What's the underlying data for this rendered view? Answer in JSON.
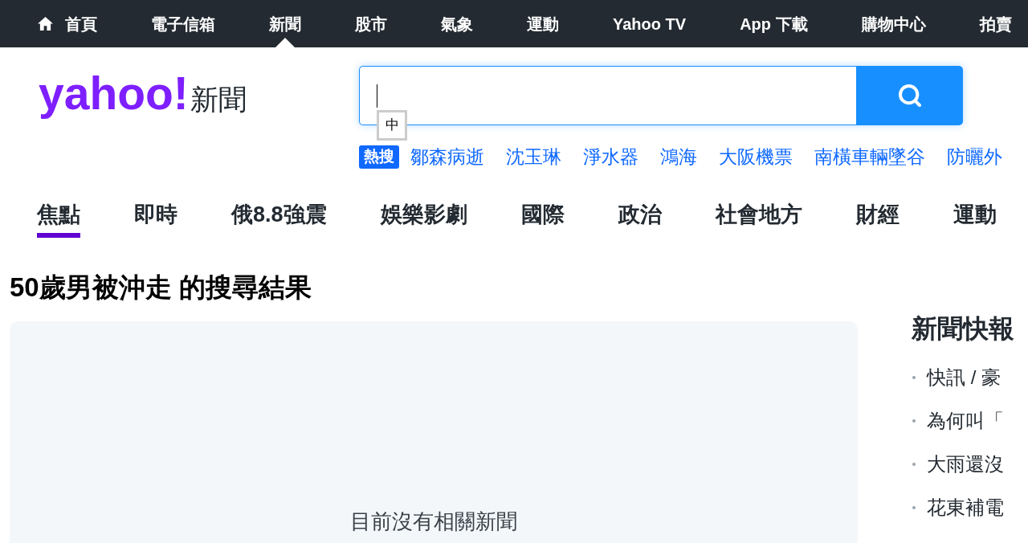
{
  "top_nav": [
    {
      "label": "首頁",
      "kind": "home",
      "selected": false
    },
    {
      "label": "電子信箱",
      "kind": "link",
      "selected": false
    },
    {
      "label": "新聞",
      "kind": "link",
      "selected": true
    },
    {
      "label": "股市",
      "kind": "link",
      "selected": false
    },
    {
      "label": "氣象",
      "kind": "link",
      "selected": false
    },
    {
      "label": "運動",
      "kind": "link",
      "selected": false
    },
    {
      "label": "Yahoo TV",
      "kind": "link",
      "selected": false
    },
    {
      "label": "App 下載",
      "kind": "link",
      "selected": false
    },
    {
      "label": "購物中心",
      "kind": "link",
      "selected": false
    },
    {
      "label": "拍賣",
      "kind": "link",
      "selected": false
    }
  ],
  "header": {
    "logo": "yahoo!",
    "logo_subtitle": "新聞"
  },
  "search": {
    "focused": true,
    "ime_indicator": "中"
  },
  "trending": {
    "badge": "熱搜",
    "terms": [
      "鄒森病逝",
      "沈玉琳",
      "淨水器",
      "鴻海",
      "大阪機票",
      "南橫車輛墜谷",
      "防曬外"
    ]
  },
  "category_tabs": [
    {
      "label": "焦點",
      "selected": true
    },
    {
      "label": "即時",
      "selected": false
    },
    {
      "label": "俄8.8強震",
      "selected": false
    },
    {
      "label": "娛樂影劇",
      "selected": false
    },
    {
      "label": "國際",
      "selected": false
    },
    {
      "label": "政治",
      "selected": false
    },
    {
      "label": "社會地方",
      "selected": false
    },
    {
      "label": "財經",
      "selected": false
    },
    {
      "label": "運動",
      "selected": false
    }
  ],
  "search_results": {
    "title": "50歲男被沖走 的搜尋結果",
    "empty_message": "目前沒有相關新聞"
  },
  "news_flash": {
    "title": "新聞快報",
    "items": [
      "快訊 / 豪",
      "為何叫「",
      "大雨還沒",
      "花東補電"
    ]
  }
}
